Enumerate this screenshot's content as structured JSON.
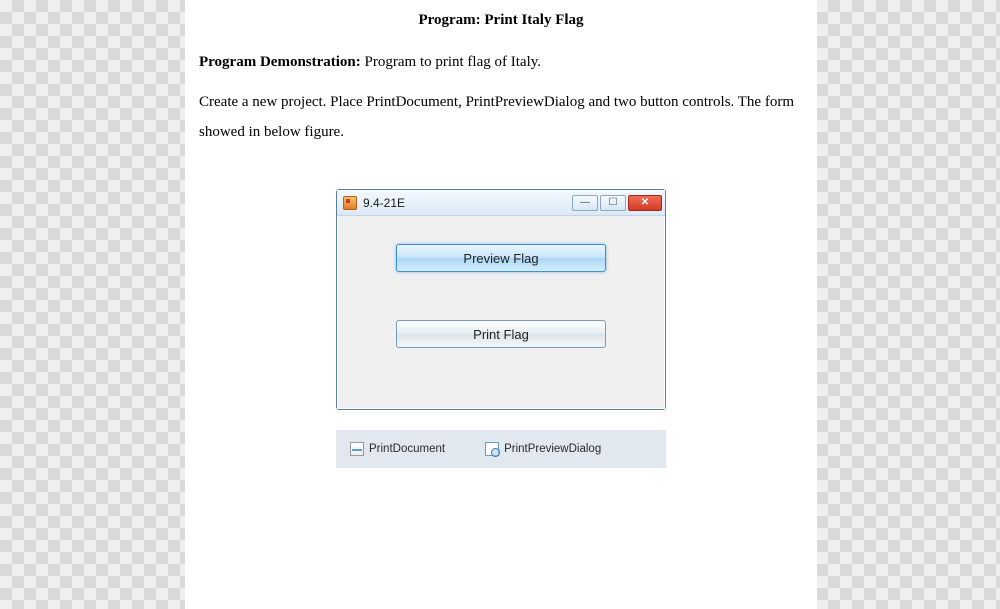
{
  "heading": "Program: Print Italy Flag",
  "demo_label": "Program Demonstration:",
  "demo_text": " Program to print flag of Italy.",
  "instructions": "Create a new project. Place PrintDocument, PrintPreviewDialog and two button controls. The form showed in below figure.",
  "window": {
    "title": "9.4-21E",
    "minimize_glyph": "—",
    "maximize_glyph": "☐",
    "close_glyph": "✕",
    "preview_button": "Preview Flag",
    "print_button": "Print Flag"
  },
  "tray": {
    "print_document": "PrintDocument",
    "print_preview_dialog": "PrintPreviewDialog"
  }
}
